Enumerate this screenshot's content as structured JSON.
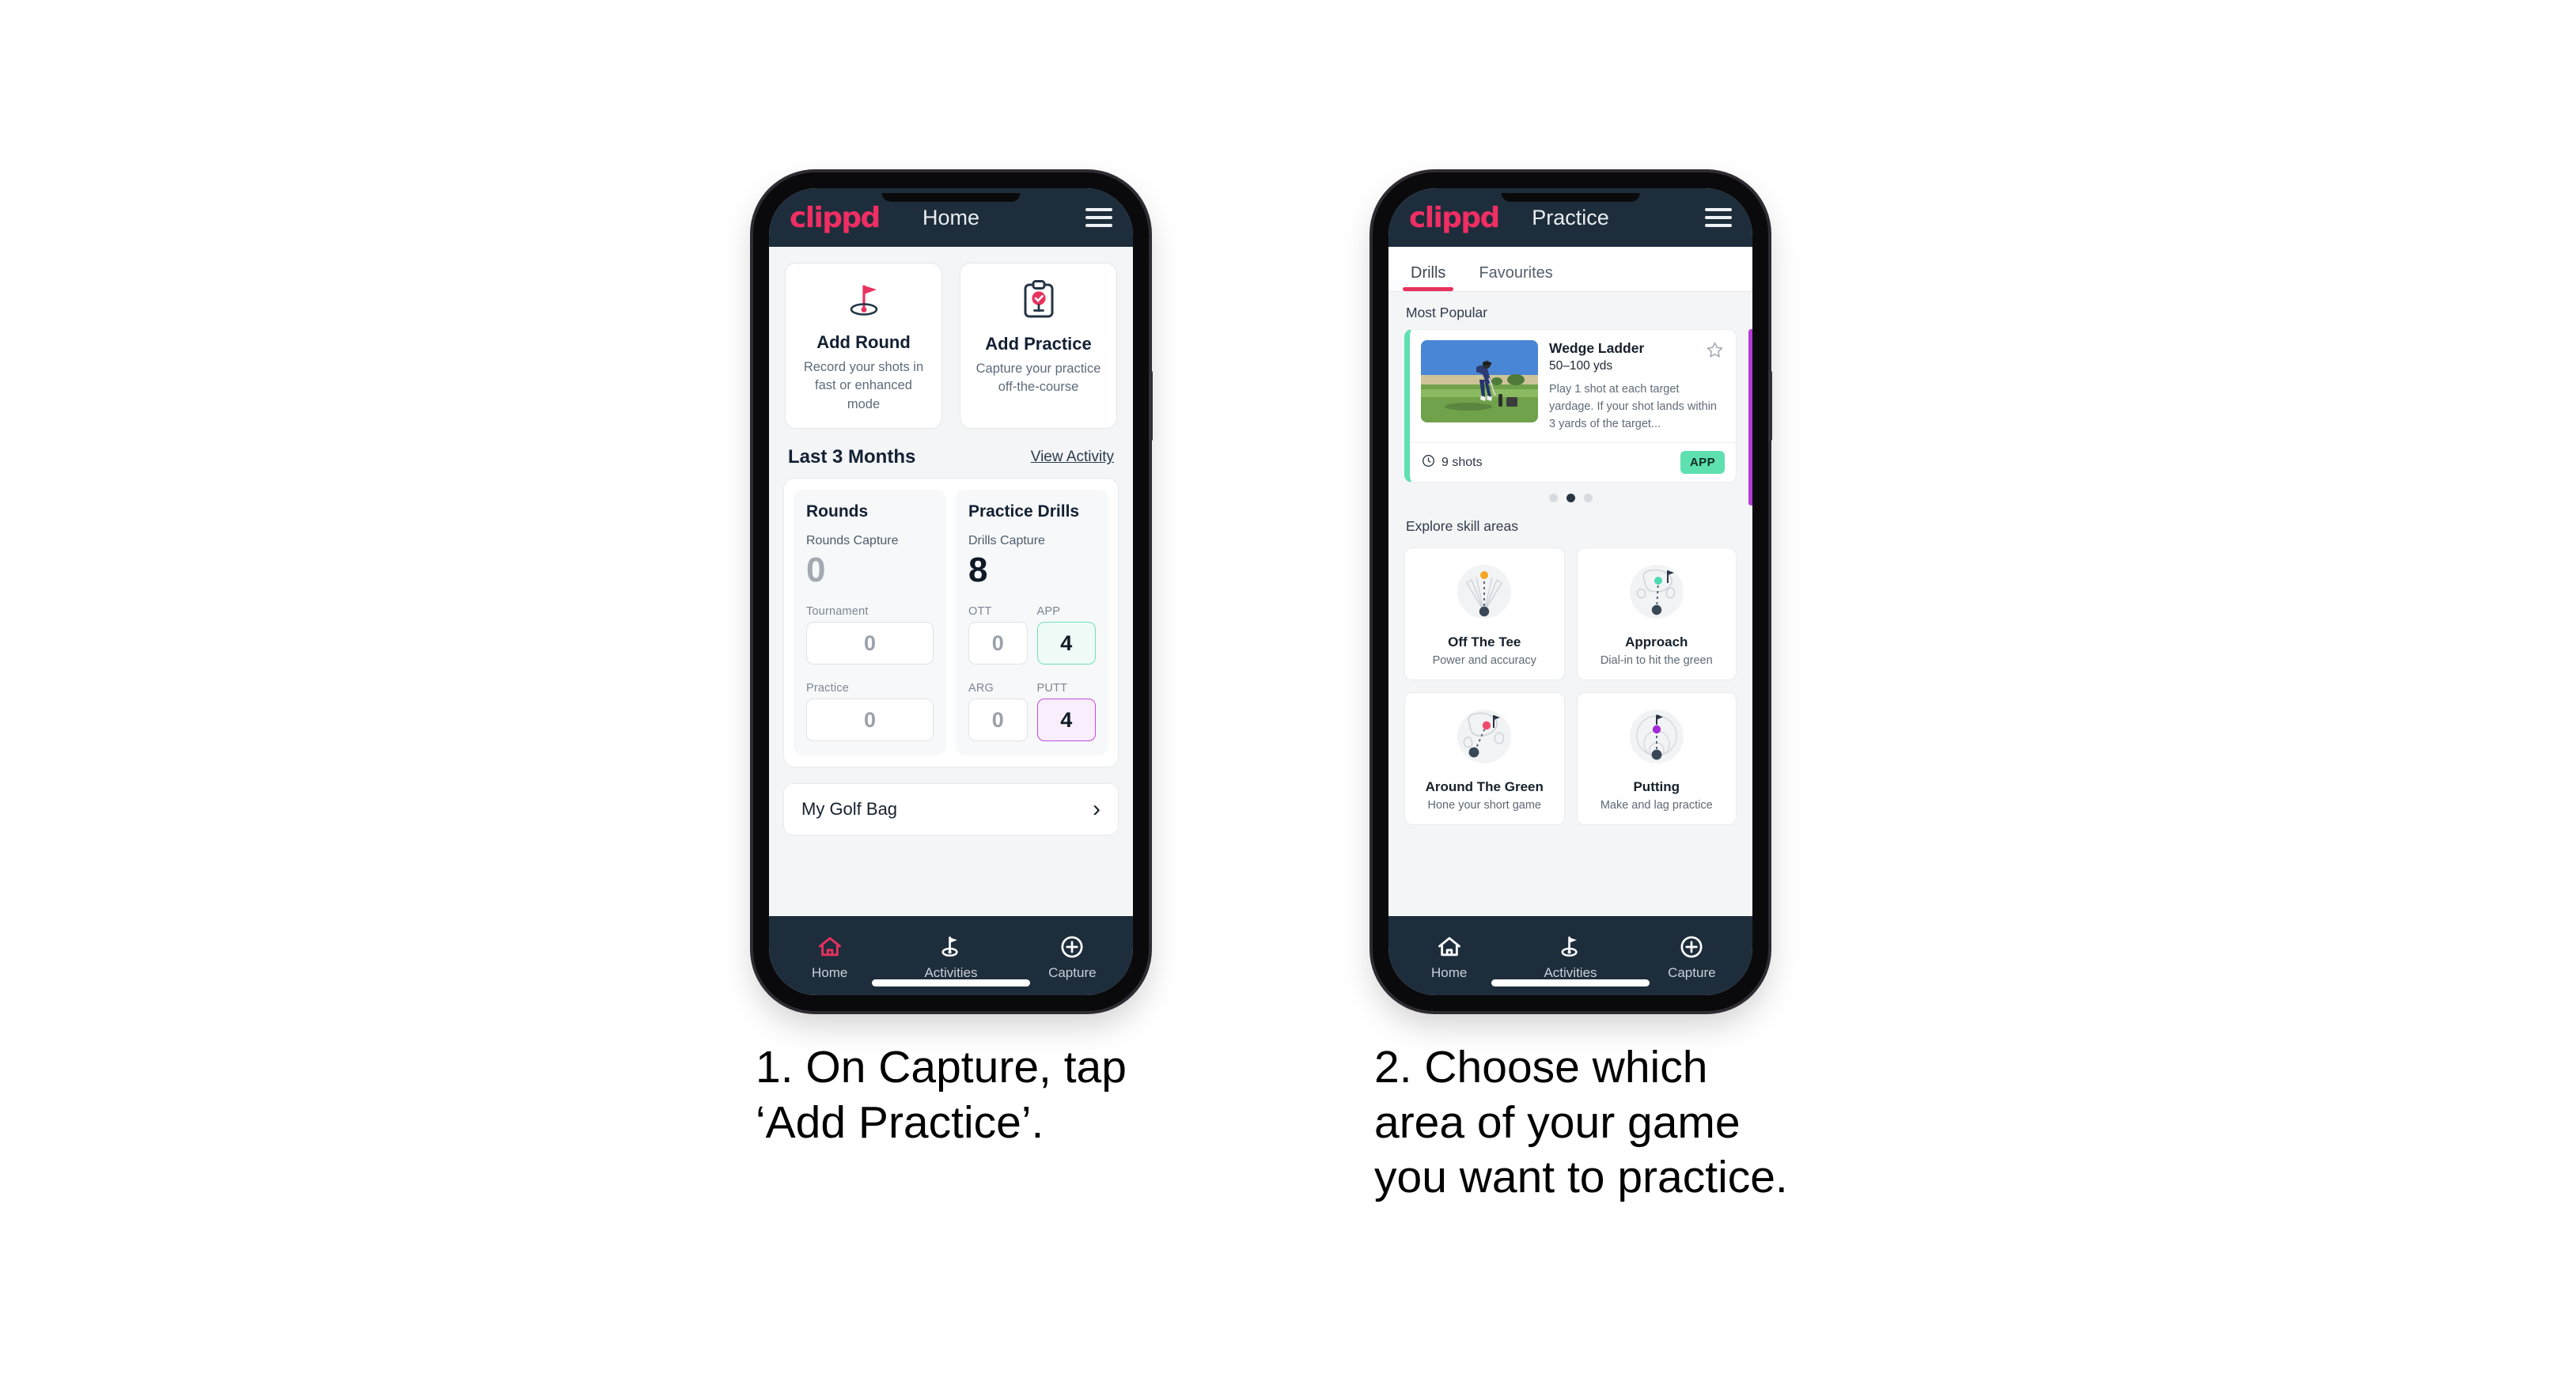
{
  "page": {
    "background": "#ffffff"
  },
  "phone1": {
    "appbar": {
      "logo": "clippd",
      "title": "Home",
      "menu_icon": "hamburger-menu-icon"
    },
    "quick_actions": [
      {
        "icon": "golf-flag-hole-icon",
        "title": "Add Round",
        "subtitle": "Record your shots in fast or enhanced mode"
      },
      {
        "icon": "clipboard-check-icon",
        "title": "Add Practice",
        "subtitle": "Capture your practice off-the-course"
      }
    ],
    "section": {
      "title": "Last 3 Months",
      "link": "View Activity"
    },
    "rounds": {
      "heading": "Rounds",
      "capture_label": "Rounds Capture",
      "capture_value": "0",
      "metrics": [
        {
          "label": "Tournament",
          "value": "0",
          "state": "muted"
        },
        {
          "label": "Practice",
          "value": "0",
          "state": "muted"
        }
      ]
    },
    "drills": {
      "heading": "Practice Drills",
      "capture_label": "Drills Capture",
      "capture_value": "8",
      "metrics": [
        {
          "label": "OTT",
          "value": "0",
          "state": "muted"
        },
        {
          "label": "APP",
          "value": "4",
          "state": "green"
        },
        {
          "label": "ARG",
          "value": "0",
          "state": "muted"
        },
        {
          "label": "PUTT",
          "value": "4",
          "state": "purple"
        }
      ]
    },
    "golf_bag": {
      "label": "My Golf Bag",
      "chevron": "chevron-right-icon"
    },
    "bottom_nav": [
      {
        "label": "Home",
        "icon": "home-icon",
        "active": true
      },
      {
        "label": "Activities",
        "icon": "golf-flag-icon",
        "active": false
      },
      {
        "label": "Capture",
        "icon": "plus-circle-icon",
        "active": false
      }
    ]
  },
  "phone2": {
    "appbar": {
      "logo": "clippd",
      "title": "Practice",
      "menu_icon": "hamburger-menu-icon"
    },
    "tabs": [
      {
        "label": "Drills",
        "active": true
      },
      {
        "label": "Favourites",
        "active": false
      }
    ],
    "most_popular_title": "Most Popular",
    "drill": {
      "thumbnail": "golfer-photo-thumbnail",
      "name": "Wedge Ladder",
      "yardage": "50–100 yds",
      "description": "Play 1 shot at each target yardage. If your shot lands within 3 yards of the target...",
      "favourite_icon": "star-outline-icon",
      "shots_icon": "clock-icon",
      "shots": "9 shots",
      "tag": "APP",
      "accent_color": "#5ee0b0",
      "next_card_accent": "#b63bd8"
    },
    "carousel_dots": {
      "count": 3,
      "active_index": 1
    },
    "explore_title": "Explore skill areas",
    "skill_areas": [
      {
        "icon": "tee-shot-dispersion-icon",
        "name": "Off The Tee",
        "subtitle": "Power and accuracy",
        "dot_color": "#f5a623"
      },
      {
        "icon": "approach-green-icon",
        "name": "Approach",
        "subtitle": "Dial-in to hit the green",
        "dot_color": "#4fd8b3"
      },
      {
        "icon": "chip-green-icon",
        "name": "Around The Green",
        "subtitle": "Hone your short game",
        "dot_color": "#ef4a6e"
      },
      {
        "icon": "putting-rings-icon",
        "name": "Putting",
        "subtitle": "Make and lag practice",
        "dot_color": "#a22bd8"
      }
    ],
    "bottom_nav": [
      {
        "label": "Home",
        "icon": "home-icon",
        "active": false
      },
      {
        "label": "Activities",
        "icon": "golf-flag-icon",
        "active": false
      },
      {
        "label": "Capture",
        "icon": "plus-circle-icon",
        "active": false
      }
    ]
  },
  "captions": {
    "step1": "1. On Capture, tap\n‘Add Practice’.",
    "step2": "2. Choose which\narea of your game\nyou want to practice."
  }
}
